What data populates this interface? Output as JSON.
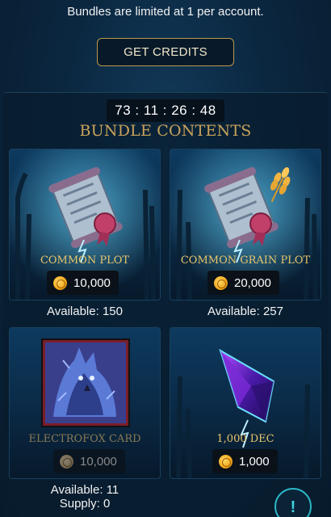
{
  "header": {
    "notice": "Bundles are limited at 1 per account.",
    "get_credits_label": "GET CREDITS"
  },
  "bundle": {
    "timer": "73 : 11 : 26 : 48",
    "title": "BUNDLE CONTENTS"
  },
  "cards": [
    {
      "name": "COMMON PLOT",
      "price": "10,000",
      "available_label": "Available:",
      "available": "150",
      "icon": "scroll-icon"
    },
    {
      "name": "COMMON GRAIN PLOT",
      "price": "20,000",
      "available_label": "Available:",
      "available": "257",
      "icon": "scroll-grain-icon"
    },
    {
      "name": "ELECTROFOX CARD",
      "price": "10,000",
      "available_label": "Available:",
      "available": "11",
      "supply_label": "Supply:",
      "supply": "0",
      "icon": "electrofox-card-art"
    },
    {
      "name": "1,000 DEC",
      "price": "1,000",
      "icon": "dec-crystal-icon"
    }
  ],
  "colors": {
    "gold": "#c9a25b",
    "accent_cyan": "#2bb7c6",
    "panel_bg": "#0b2740"
  },
  "fab": {
    "label": "!"
  }
}
